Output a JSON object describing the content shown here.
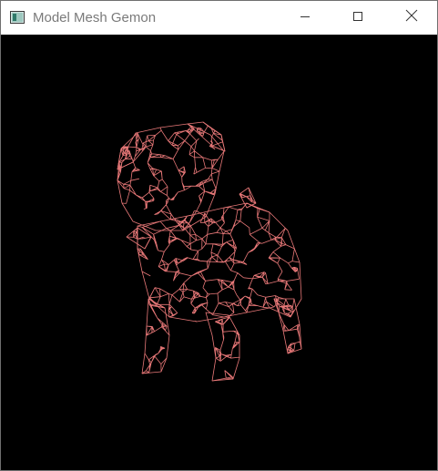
{
  "window": {
    "title": "Model Mesh Gemon",
    "icons": {
      "app": "app-window-icon",
      "minimize": "minimize-icon",
      "maximize": "maximize-icon",
      "close": "close-icon"
    }
  },
  "viewport": {
    "background_color": "#000000",
    "mesh_color": "#e87878",
    "render_mode": "wireframe",
    "model": "pug dog"
  }
}
